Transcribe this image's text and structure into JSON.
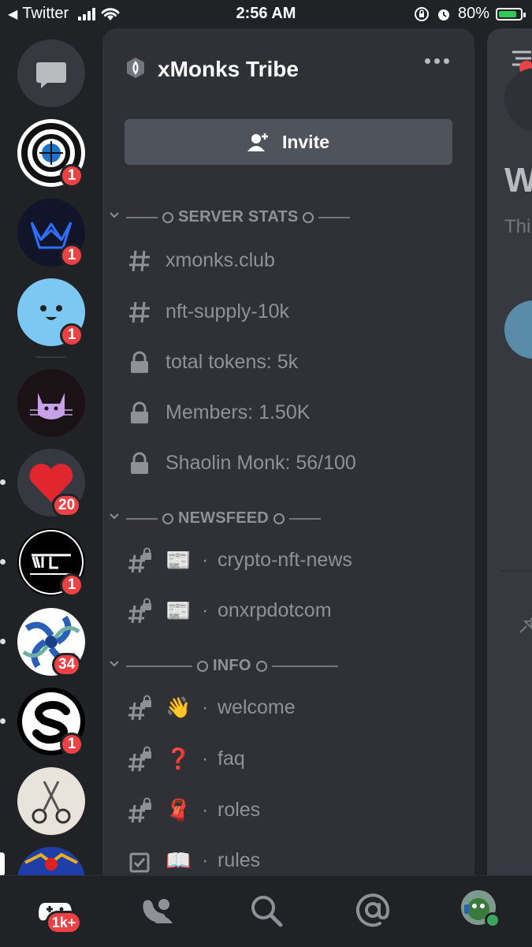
{
  "status_bar": {
    "back_app": "Twitter",
    "time": "2:56 AM",
    "battery": "80%"
  },
  "server_rail": {
    "badges": [
      "1",
      "1",
      "1",
      "20",
      "1",
      "34",
      "1"
    ]
  },
  "server": {
    "name": "xMonks Tribe",
    "invite_label": "Invite"
  },
  "categories": [
    {
      "label": "SERVER STATS"
    },
    {
      "label": "NEWSFEED"
    },
    {
      "label": "INFO"
    }
  ],
  "channels": {
    "stats": [
      {
        "name": "xmonks.club"
      },
      {
        "name": "nft-supply-10k"
      },
      {
        "name": "total tokens: 5k"
      },
      {
        "name": "Members: 1.50K"
      },
      {
        "name": "Shaolin Monk: 56/100"
      }
    ],
    "news": [
      {
        "emoji": "📰",
        "name": "crypto-nft-news"
      },
      {
        "emoji": "📰",
        "name": "onxrpdotcom"
      }
    ],
    "info": [
      {
        "emoji": "👋",
        "name": "welcome"
      },
      {
        "emoji": "❓",
        "name": "faq"
      },
      {
        "emoji": "🧣",
        "name": "roles"
      },
      {
        "emoji": "📖",
        "name": "rules"
      }
    ],
    "separator": "·"
  },
  "right_peek": {
    "title_fragment": "W",
    "sub_fragment": "Thi"
  },
  "tab_bar": {
    "home_badge": "1k+"
  },
  "colors": {
    "background": "#202225",
    "panel": "#2f3136",
    "badge": "#ed4245",
    "muted": "#8e9297"
  }
}
